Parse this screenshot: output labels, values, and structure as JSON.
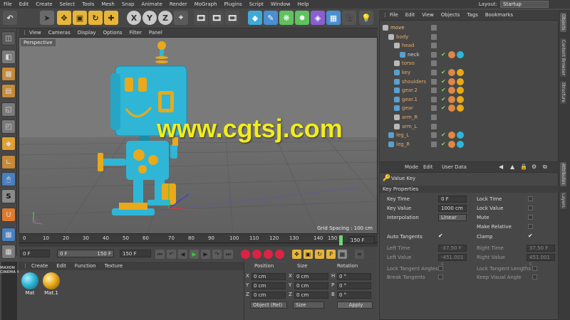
{
  "menu": [
    "File",
    "Edit",
    "Create",
    "Select",
    "Tools",
    "Mesh",
    "Snap",
    "Animate",
    "Render",
    "MoGraph",
    "Plugins",
    "Script",
    "Window",
    "Help"
  ],
  "layout": {
    "label": "Layout:",
    "value": "Startup"
  },
  "toolbar": {
    "x": "X",
    "y": "Y",
    "z": "Z"
  },
  "viewport": {
    "menu": [
      "View",
      "Cameras",
      "Display",
      "Options",
      "Filter",
      "Panel"
    ],
    "label": "Perspective",
    "grid_spacing": "Grid Spacing : 100 cm"
  },
  "watermark": "www.cgtsj.com",
  "timeline": {
    "ticks": [
      "0",
      "10",
      "20",
      "30",
      "40",
      "50",
      "60",
      "70",
      "80",
      "90",
      "100",
      "110",
      "120",
      "130",
      "140",
      "150"
    ],
    "current_frame": "150 F",
    "start": "0 F",
    "range_start": "0 F",
    "range_end": "150 F",
    "end": "150 F"
  },
  "materials": {
    "menu": [
      "Create",
      "Edit",
      "Function",
      "Texture"
    ],
    "items": [
      {
        "label": "Mat",
        "color": "#2fb6d6"
      },
      {
        "label": "Mat.1",
        "color": "#e9a91a"
      }
    ]
  },
  "maxon": "MAXON CINEMA 4D",
  "coords": {
    "headers": [
      "Position",
      "Size",
      "Rotation"
    ],
    "rows": [
      {
        "pa": "X",
        "pv": "0 cm",
        "sa": "X",
        "sv": "0 cm",
        "ra": "H",
        "rv": "0 °"
      },
      {
        "pa": "Y",
        "pv": "0 cm",
        "sa": "Y",
        "sv": "0 cm",
        "ra": "P",
        "rv": "0 °"
      },
      {
        "pa": "Z",
        "pv": "0 cm",
        "sa": "Z",
        "sv": "0 cm",
        "ra": "B",
        "rv": "0 °"
      }
    ],
    "mode": "Object (Rel)",
    "size_mode": "Size",
    "apply": "Apply"
  },
  "objects": {
    "menu": [
      "File",
      "Edit",
      "View",
      "Objects",
      "Tags",
      "Bookmarks"
    ],
    "items": [
      {
        "name": "move",
        "indent": 0,
        "color": "#f0c27a",
        "tags": 0
      },
      {
        "name": "body",
        "indent": 1,
        "color": "#e8a96a",
        "tags": 0
      },
      {
        "name": "head",
        "indent": 2,
        "color": "#e8a96a",
        "tags": 0
      },
      {
        "name": "neck",
        "indent": 3,
        "color": "#d8d8d8",
        "tags": 2
      },
      {
        "name": "torso",
        "indent": 2,
        "color": "#e8a96a",
        "tags": 0
      },
      {
        "name": "key",
        "indent": 2,
        "color": "#e8a96a",
        "tags": 2
      },
      {
        "name": "shoulders",
        "indent": 2,
        "color": "#e8a96a",
        "tags": 2
      },
      {
        "name": "gear.2",
        "indent": 2,
        "color": "#e8a96a",
        "tags": 2
      },
      {
        "name": "gear.1",
        "indent": 2,
        "color": "#e8a96a",
        "tags": 2
      },
      {
        "name": "gear",
        "indent": 2,
        "color": "#e8a96a",
        "tags": 2
      },
      {
        "name": "arm_R",
        "indent": 2,
        "color": "#e8a96a",
        "tags": 0
      },
      {
        "name": "arm_L",
        "indent": 2,
        "color": "#e8a96a",
        "tags": 0
      },
      {
        "name": "leg_L",
        "indent": 1,
        "color": "#e8a96a",
        "tags": 2
      },
      {
        "name": "leg_R",
        "indent": 1,
        "color": "#e8a96a",
        "tags": 2
      }
    ]
  },
  "attributes": {
    "tabs": [
      "Mode",
      "Edit",
      "User Data"
    ],
    "title": "Value Key",
    "section": "Key Properties",
    "fields": {
      "key_time": {
        "label": "Key Time",
        "value": "0 F"
      },
      "key_value": {
        "label": "Key Value",
        "value": "1000 cm"
      },
      "interpolation": {
        "label": "Interpolation",
        "value": "Linear"
      },
      "lock_time": "Lock Time",
      "lock_value": "Lock Value",
      "mute": "Mute",
      "make_relative": "Make Relative",
      "auto_tangents": "Auto Tangents",
      "clamp": "Clamp",
      "left_time": {
        "label": "Left Time",
        "value": "-37.50 F"
      },
      "left_value": {
        "label": "Left Value",
        "value": "-451.001 c"
      },
      "right_time": {
        "label": "Right Time",
        "value": "37.50 F"
      },
      "right_value": {
        "label": "Right Value",
        "value": "451.001 c"
      },
      "break_tangents": "Break Tangents",
      "lock_tangent_angles": "Lock Tangent Angles",
      "lock_tangent_lengths": "Lock Tangent Lengths",
      "keep_visual_angle": "Keep Visual Angle"
    }
  },
  "right_tabs": [
    "Objects",
    "Content Browser",
    "Structure",
    "Attributes",
    "Layers"
  ]
}
